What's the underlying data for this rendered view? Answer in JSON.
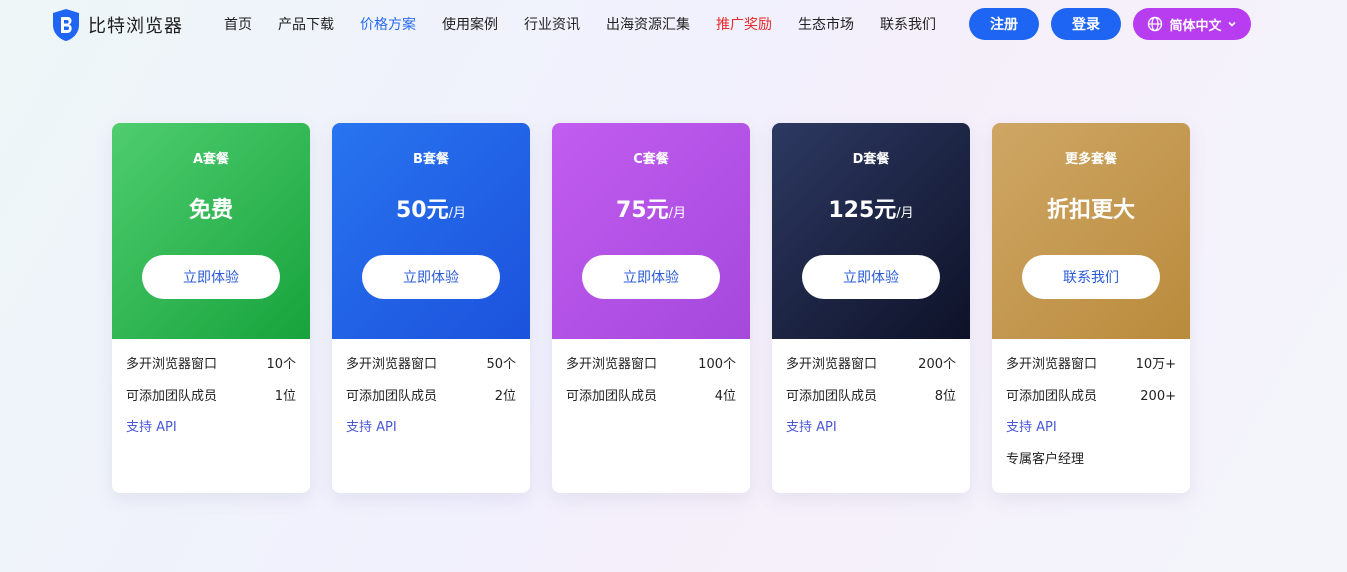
{
  "brand": {
    "name": "比特浏览器",
    "color": "#1e65f3"
  },
  "nav": [
    {
      "label": "首页",
      "state": "normal"
    },
    {
      "label": "产品下载",
      "state": "normal"
    },
    {
      "label": "价格方案",
      "state": "active"
    },
    {
      "label": "使用案例",
      "state": "normal"
    },
    {
      "label": "行业资讯",
      "state": "normal"
    },
    {
      "label": "出海资源汇集",
      "state": "normal"
    },
    {
      "label": "推广奖励",
      "state": "promo"
    },
    {
      "label": "生态市场",
      "state": "normal"
    },
    {
      "label": "联系我们",
      "state": "normal"
    }
  ],
  "actions": {
    "register": "注册",
    "login": "登录",
    "language": "简体中文",
    "language_icon": "globe-icon"
  },
  "plans": [
    {
      "name": "A套餐",
      "price": "免费",
      "per": "",
      "button": "立即体验",
      "theme": "green",
      "features": [
        {
          "label": "多开浏览器窗口",
          "value": "10个"
        },
        {
          "label": "可添加团队成员",
          "value": "1位"
        }
      ],
      "api": "支持 API",
      "extra": ""
    },
    {
      "name": "B套餐",
      "price": "50元",
      "per": "/月",
      "button": "立即体验",
      "theme": "blue",
      "features": [
        {
          "label": "多开浏览器窗口",
          "value": "50个"
        },
        {
          "label": "可添加团队成员",
          "value": "2位"
        }
      ],
      "api": "支持 API",
      "extra": ""
    },
    {
      "name": "C套餐",
      "price": "75元",
      "per": "/月",
      "button": "立即体验",
      "theme": "purple",
      "features": [
        {
          "label": "多开浏览器窗口",
          "value": "100个"
        },
        {
          "label": "可添加团队成员",
          "value": "4位"
        }
      ],
      "api": "",
      "extra": ""
    },
    {
      "name": "D套餐",
      "price": "125元",
      "per": "/月",
      "button": "立即体验",
      "theme": "navy",
      "features": [
        {
          "label": "多开浏览器窗口",
          "value": "200个"
        },
        {
          "label": "可添加团队成员",
          "value": "8位"
        }
      ],
      "api": "支持 API",
      "extra": ""
    },
    {
      "name": "更多套餐",
      "price": "折扣更大",
      "per": "",
      "button": "联系我们",
      "theme": "gold",
      "features": [
        {
          "label": "多开浏览器窗口",
          "value": "10万+"
        },
        {
          "label": "可添加团队成员",
          "value": "200+"
        }
      ],
      "api": "支持 API",
      "extra": "专属客户经理"
    }
  ]
}
